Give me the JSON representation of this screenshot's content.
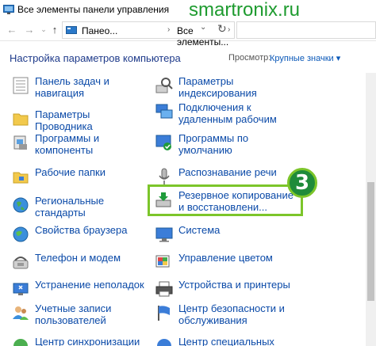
{
  "window": {
    "title": "Все элементы панели управления"
  },
  "watermark": "smartronix.ru",
  "address": {
    "crumb1": "Панель управления",
    "crumb1_short": "Панео...",
    "crumb2": "Все элементы...",
    "sep": "›"
  },
  "header": {
    "title": "Настройка параметров компьютера",
    "view_label": "Просмотр:",
    "view_value": "Крупные значки ▾"
  },
  "left_items": [
    {
      "label": "Панель задач и\nнавигация",
      "icon": "taskbar-icon"
    },
    {
      "label": "Параметры Проводника",
      "icon": "folder-options-icon"
    },
    {
      "label": "Программы и\nкомпоненты",
      "icon": "programs-icon"
    },
    {
      "label": "Рабочие папки",
      "icon": "work-folders-icon"
    },
    {
      "label": "Региональные стандарты",
      "icon": "region-icon"
    },
    {
      "label": "Свойства браузера",
      "icon": "browser-icon"
    },
    {
      "label": "Телефон и модем",
      "icon": "phone-modem-icon"
    },
    {
      "label": "Устранение неполадок",
      "icon": "troubleshoot-icon"
    },
    {
      "label": "Учетные записи\nпользователей",
      "icon": "user-accounts-icon"
    },
    {
      "label": "Центр синхронизации",
      "icon": "sync-center-icon"
    }
  ],
  "right_items": [
    {
      "label": "Параметры\nиндексирования",
      "icon": "indexing-icon"
    },
    {
      "label": "Подключения к\nудаленным рабочим",
      "icon": "remote-desktop-icon"
    },
    {
      "label": "Программы по\nумолчанию",
      "icon": "default-programs-icon"
    },
    {
      "label": "Распознавание речи",
      "icon": "microphone-icon"
    },
    {
      "label": "Резервное копирование\nи восстановлени...",
      "icon": "backup-restore-icon"
    },
    {
      "label": "Система",
      "icon": "system-icon"
    },
    {
      "label": "Управление цветом",
      "icon": "color-management-icon"
    },
    {
      "label": "Устройства и принтеры",
      "icon": "printer-icon"
    },
    {
      "label": "Центр безопасности и\nобслуживания",
      "icon": "security-flag-icon"
    },
    {
      "label": "Центр специальных",
      "icon": "accessibility-icon"
    }
  ],
  "step_badge": "3",
  "colors": {
    "link": "#0b4aa8",
    "watermark": "#1e9b2f",
    "highlight": "#7cc52a",
    "badge": "#1f8b3a"
  }
}
